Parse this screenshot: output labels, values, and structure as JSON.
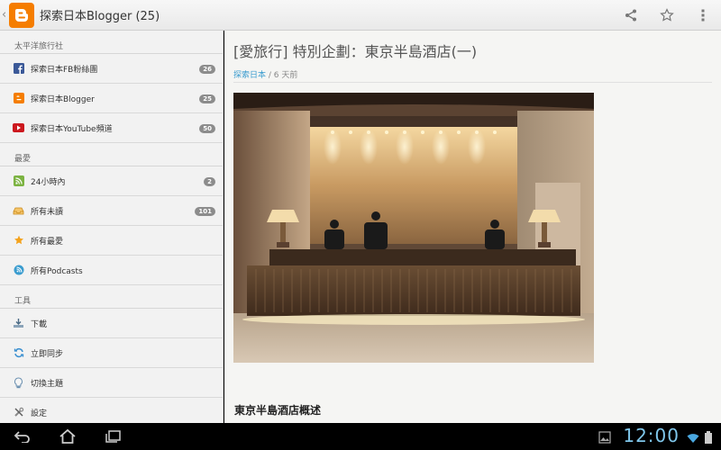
{
  "app": {
    "title": "探索日本Blogger (25)"
  },
  "sidebar": {
    "sections": [
      {
        "header": "太平洋旅行社",
        "items": [
          {
            "label": "探索日本FB粉絲團",
            "count": "26",
            "icon": "facebook-icon"
          },
          {
            "label": "探索日本Blogger",
            "count": "25",
            "icon": "blogger-icon"
          },
          {
            "label": "探索日本YouTube頻道",
            "count": "50",
            "icon": "youtube-icon"
          }
        ]
      },
      {
        "header": "最愛",
        "items": [
          {
            "label": "24小時內",
            "count": "2",
            "icon": "rss-icon"
          },
          {
            "label": "所有未讀",
            "count": "101",
            "icon": "inbox-icon"
          },
          {
            "label": "所有最愛",
            "icon": "star-icon"
          },
          {
            "label": "所有Podcasts",
            "icon": "podcast-icon"
          }
        ]
      },
      {
        "header": "工具",
        "items": [
          {
            "label": "下載",
            "icon": "download-icon"
          },
          {
            "label": "立即同步",
            "icon": "sync-icon"
          },
          {
            "label": "切換主題",
            "icon": "lightbulb-icon"
          },
          {
            "label": "設定",
            "icon": "settings-tools-icon"
          }
        ]
      }
    ]
  },
  "article": {
    "title": "[愛旅行] 特別企劃：東京半島酒店(一)",
    "source": "探索日本",
    "time": "/ 6 天前",
    "section_heading": "東京半島酒店概述"
  },
  "status": {
    "clock": "12:00"
  },
  "colors": {
    "accent": "#3a9ccf",
    "blogger": "#f57d00",
    "facebook": "#3b5998",
    "youtube": "#cc181e",
    "clock": "#7fc6ea"
  }
}
